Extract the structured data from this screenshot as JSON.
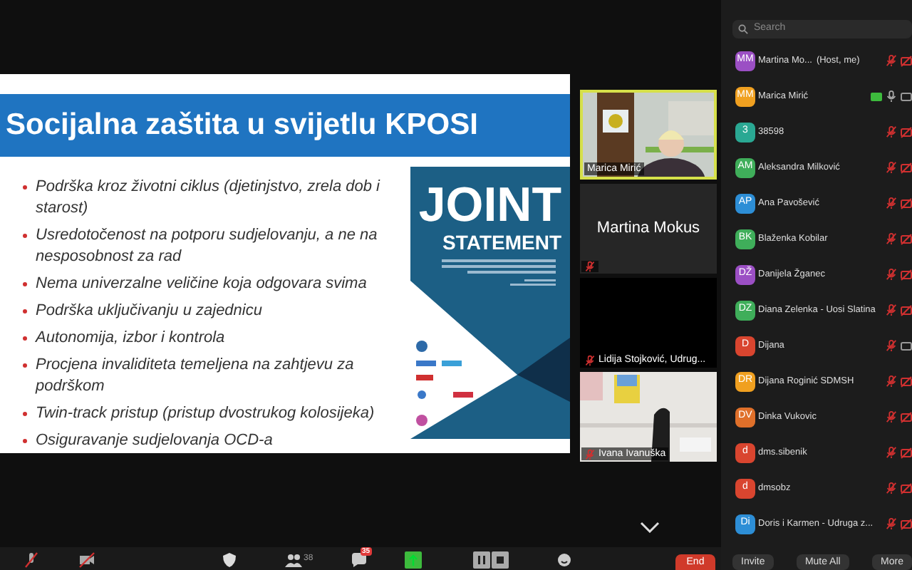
{
  "slide": {
    "title": "Socijalna zaštita u svijetlu KPOSI",
    "bullets": [
      "Podrška kroz životni ciklus (djetinjstvo, zrela dob i starost)",
      "Usredotočenost na potporu sudjelovanju, a ne na nesposobnost za rad",
      "Nema univerzalne veličine koja odgovara svima",
      "Podrška uključivanju u zajednicu",
      "Autonomija, izbor i kontrola",
      "Procjena invaliditeta temeljena na zahtjevu za podrškom",
      "Twin-track pristup (pristup dvostrukog kolosijeka)",
      "Osiguravanje sudjelovanja OCD-a"
    ],
    "cover": {
      "title": "JOINT",
      "subtitle": "STATEMENT"
    }
  },
  "videos": [
    {
      "kind": "camera",
      "name": "Marica Mirić",
      "speaking": true,
      "muted": false
    },
    {
      "kind": "name",
      "name": "Martina Mokus",
      "speaking": false,
      "muted": true
    },
    {
      "kind": "dark",
      "name": "Lidija Stojković, Udrug...",
      "speaking": false,
      "muted": true
    },
    {
      "kind": "room",
      "name": "Ivana Ivanuška",
      "speaking": false,
      "muted": true
    }
  ],
  "search": {
    "placeholder": "Search"
  },
  "participants": [
    {
      "initials": "MM",
      "color": "#9b4fc4",
      "name": "Martina Mo...",
      "role": "(Host, me)",
      "sharing": false,
      "muted": true,
      "video_off": true
    },
    {
      "initials": "MM",
      "color": "#f0a020",
      "name": "Marica Mirić",
      "sharing": true,
      "muted": false,
      "video_off": false
    },
    {
      "initials": "3",
      "color": "#2aa893",
      "name": "38598",
      "sharing": false,
      "muted": true,
      "video_off": true
    },
    {
      "initials": "AM",
      "color": "#3fae5a",
      "name": "Aleksandra Milković",
      "sharing": false,
      "muted": true,
      "video_off": true
    },
    {
      "initials": "AP",
      "color": "#2d8ed6",
      "name": "Ana Pavošević",
      "sharing": false,
      "muted": true,
      "video_off": true
    },
    {
      "initials": "BK",
      "color": "#3fae5a",
      "name": "Blaženka Kobilar",
      "sharing": false,
      "muted": true,
      "video_off": true
    },
    {
      "initials": "DŽ",
      "color": "#9b4fc4",
      "name": "Danijela Žganec",
      "sharing": false,
      "muted": true,
      "video_off": true
    },
    {
      "initials": "DZ",
      "color": "#3fae5a",
      "name": "Diana Zelenka - Uosi Slatina",
      "sharing": false,
      "muted": true,
      "video_off": true
    },
    {
      "initials": "D",
      "color": "#d9452f",
      "name": "Dijana",
      "sharing": false,
      "muted": true,
      "video_off": false
    },
    {
      "initials": "DR",
      "color": "#f0a020",
      "name": "Dijana Roginić SDMSH",
      "sharing": false,
      "muted": true,
      "video_off": true
    },
    {
      "initials": "DV",
      "color": "#e0702a",
      "name": "Dinka Vukovic",
      "sharing": false,
      "muted": true,
      "video_off": true
    },
    {
      "initials": "d",
      "color": "#d9452f",
      "name": "dms.sibenik",
      "sharing": false,
      "muted": true,
      "video_off": true
    },
    {
      "initials": "d",
      "color": "#d9452f",
      "name": "dmsobz",
      "sharing": false,
      "muted": true,
      "video_off": true
    },
    {
      "initials": "Di",
      "color": "#2d8ed6",
      "name": "Doris i Karmen - Udruga z...",
      "sharing": false,
      "muted": true,
      "video_off": true
    }
  ],
  "panel_buttons": [
    "Invite",
    "Mute All",
    "More"
  ],
  "toolbar": {
    "participant_count": "38",
    "chat_badge": "35",
    "end": "End"
  }
}
